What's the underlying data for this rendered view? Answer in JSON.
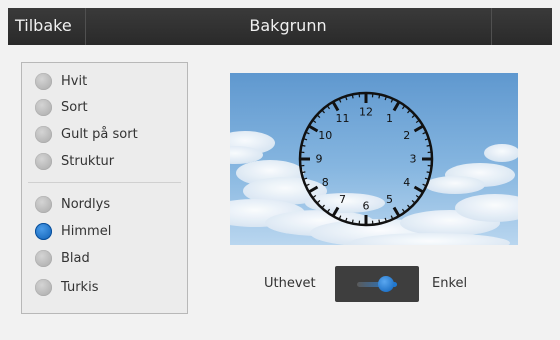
{
  "header": {
    "back_label": "Tilbake",
    "title": "Bakgrunn"
  },
  "background_options": [
    {
      "label": "Hvit",
      "selected": false
    },
    {
      "label": "Sort",
      "selected": false
    },
    {
      "label": "Gult på sort",
      "selected": false
    },
    {
      "label": "Struktur",
      "selected": false
    },
    {
      "label": "Nordlys",
      "selected": false
    },
    {
      "label": "Himmel",
      "selected": true
    },
    {
      "label": "Blad",
      "selected": false
    },
    {
      "label": "Turkis",
      "selected": false
    }
  ],
  "preview": {
    "clock_numbers": [
      "12",
      "1",
      "2",
      "3",
      "4",
      "5",
      "6",
      "7",
      "8",
      "9",
      "10",
      "11"
    ]
  },
  "contrast_toggle": {
    "left_label": "Uthevet",
    "right_label": "Enkel",
    "selected": "Enkel"
  },
  "colors": {
    "accent": "#1c7ad8",
    "topbar": "#2f2f2f"
  }
}
